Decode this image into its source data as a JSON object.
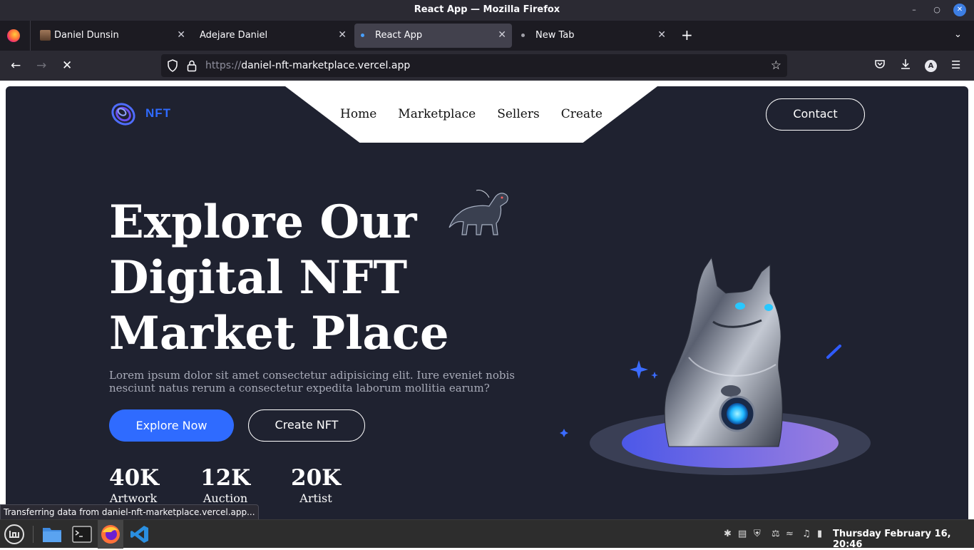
{
  "window": {
    "title": "React App — Mozilla Firefox"
  },
  "tabs": [
    {
      "label": "Daniel Dunsin",
      "active": false
    },
    {
      "label": "Adejare Daniel",
      "active": false
    },
    {
      "label": "React App",
      "active": true
    },
    {
      "label": "New Tab",
      "active": false
    }
  ],
  "urlbar": {
    "protocol": "https://",
    "host": "daniel-nft-marketplace.vercel.app"
  },
  "site": {
    "logo_text": "NFT",
    "nav": [
      "Home",
      "Marketplace",
      "Sellers",
      "Create"
    ],
    "contact_label": "Contact",
    "hero": {
      "title_lines": [
        "Explore Our",
        "Digital NFT",
        "Market Place"
      ],
      "subtitle": "Lorem ipsum dolor sit amet consectetur adipisicing elit. Iure eveniet nobis nesciunt natus rerum a consectetur expedita laborum mollitia earum?",
      "primary_button": "Explore Now",
      "secondary_button": "Create NFT"
    },
    "stats": [
      {
        "value": "40K",
        "label": "Artwork"
      },
      {
        "value": "12K",
        "label": "Auction"
      },
      {
        "value": "20K",
        "label": "Artist"
      }
    ],
    "colors": {
      "background": "#1f2230",
      "accent": "#2f6bff",
      "text": "#ffffff"
    }
  },
  "status_text": "Transferring data from daniel-nft-marketplace.vercel.app...",
  "taskbar": {
    "apps": [
      "menu-icon",
      "files-icon",
      "terminal-icon",
      "firefox-icon",
      "vscode-icon"
    ],
    "clock": "Thursday February 16, 20:46"
  }
}
